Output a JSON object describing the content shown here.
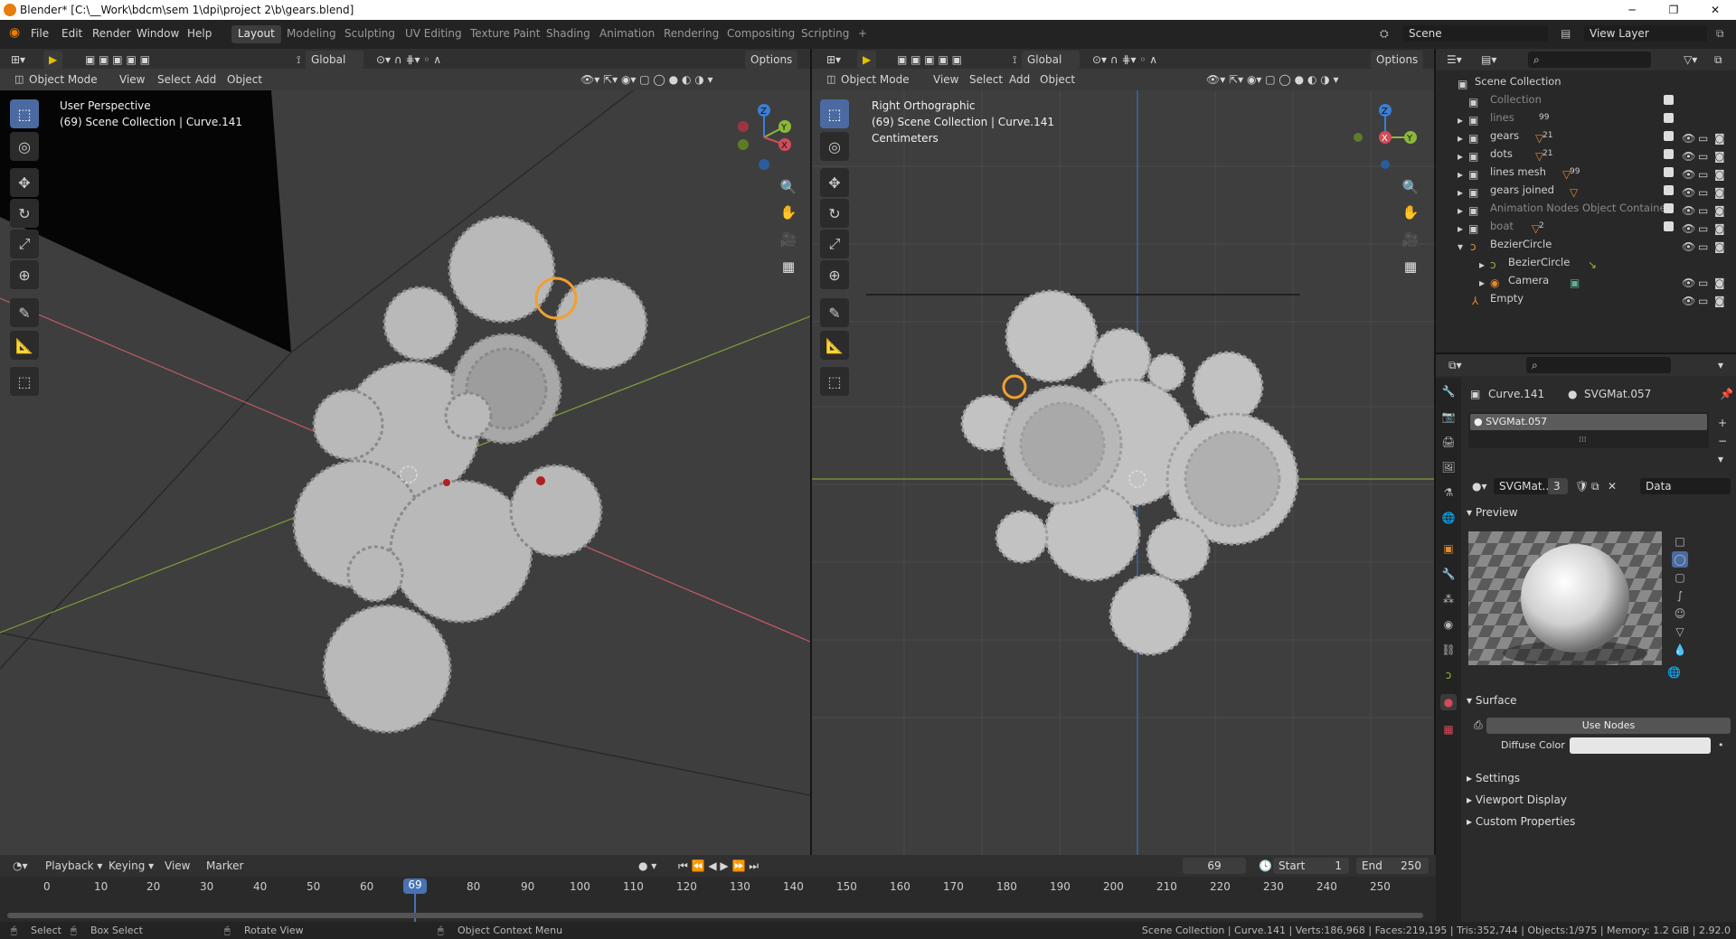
{
  "window": {
    "title": "Blender* [C:\\__Work\\bdcm\\sem 1\\dpi\\project 2\\b\\gears.blend]",
    "controls": [
      "─",
      "❐",
      "✕"
    ]
  },
  "menubar": {
    "menus": [
      "File",
      "Edit",
      "Render",
      "Window",
      "Help"
    ],
    "workspaces": [
      "Layout",
      "Modeling",
      "Sculpting",
      "UV Editing",
      "Texture Paint",
      "Shading",
      "Animation",
      "Rendering",
      "Compositing",
      "Scripting"
    ],
    "active_workspace": "Layout",
    "add_tab": "+",
    "scene": "Scene",
    "view_layer": "View Layer"
  },
  "viewport_left": {
    "transform_orientation": "Global",
    "options_label": "Options",
    "mode": "Object Mode",
    "menus": [
      "View",
      "Select",
      "Add",
      "Object"
    ],
    "overlay_lines": [
      "User Perspective",
      "(69) Scene Collection | Curve.141"
    ],
    "gizmo_axes": [
      "Z",
      "Y",
      "X"
    ]
  },
  "viewport_right": {
    "transform_orientation": "Global",
    "options_label": "Options",
    "mode": "Object Mode",
    "menus": [
      "View",
      "Select",
      "Add",
      "Object"
    ],
    "overlay_lines": [
      "Right Orthographic",
      "(69) Scene Collection | Curve.141",
      "Centimeters"
    ],
    "gizmo_axes": [
      "Z",
      "Y",
      "X"
    ]
  },
  "outliner": {
    "root": "Scene Collection",
    "rows": [
      {
        "name": "Collection",
        "badge": "",
        "dim": true
      },
      {
        "name": "lines",
        "badge": "99",
        "dim": true
      },
      {
        "name": "gears",
        "badge": "21",
        "dim": false
      },
      {
        "name": "dots",
        "badge": "21",
        "dim": false
      },
      {
        "name": "lines mesh",
        "badge": "99",
        "dim": false
      },
      {
        "name": "gears joined",
        "badge": "",
        "dim": false
      },
      {
        "name": "Animation Nodes Object Container",
        "badge": "",
        "dim": true
      },
      {
        "name": "boat",
        "badge": "2",
        "dim": true
      },
      {
        "name": "BezierCircle",
        "badge": "",
        "dim": false
      },
      {
        "name": "BezierCircle",
        "badge": "",
        "dim": false
      },
      {
        "name": "Camera",
        "badge": "",
        "dim": false
      },
      {
        "name": "Empty",
        "badge": "",
        "dim": false
      }
    ]
  },
  "properties": {
    "object": "Curve.141",
    "material": "SVGMat.057",
    "slot": "SVGMat.057",
    "material_field": "SVGMat...",
    "user_count": "3",
    "link": "Data",
    "sections": {
      "preview": "Preview",
      "surface": "Surface",
      "settings": "Settings",
      "viewport_display": "Viewport Display",
      "custom_properties": "Custom Properties"
    },
    "use_nodes": "Use Nodes",
    "diffuse_label": "Diffuse Color",
    "diffuse_color": "#e6e6e6"
  },
  "timeline": {
    "menus": [
      "Playback",
      "Keying",
      "View",
      "Marker"
    ],
    "current_frame": "69",
    "start_label": "Start",
    "start": "1",
    "end_label": "End",
    "end": "250",
    "ticks": [
      "0",
      "10",
      "20",
      "30",
      "40",
      "50",
      "60",
      "69",
      "80",
      "90",
      "100",
      "110",
      "120",
      "130",
      "140",
      "150",
      "160",
      "170",
      "180",
      "190",
      "200",
      "210",
      "220",
      "230",
      "240",
      "250"
    ]
  },
  "statusbar": {
    "select": "Select",
    "box_select": "Box Select",
    "rotate_view": "Rotate View",
    "context_menu": "Object Context Menu",
    "stats": "Scene Collection | Curve.141 | Verts:186,968 | Faces:219,195 | Tris:352,744 | Objects:1/975 | Memory: 1.2 GiB | 2.92.0"
  },
  "colors": {
    "accent": "#4b6aa1",
    "selection": "#f0a030",
    "axis_x": "#d14c5a",
    "axis_y": "#8cb83a",
    "axis_z": "#3b7ed4",
    "frame_marker": "#4772b3"
  }
}
